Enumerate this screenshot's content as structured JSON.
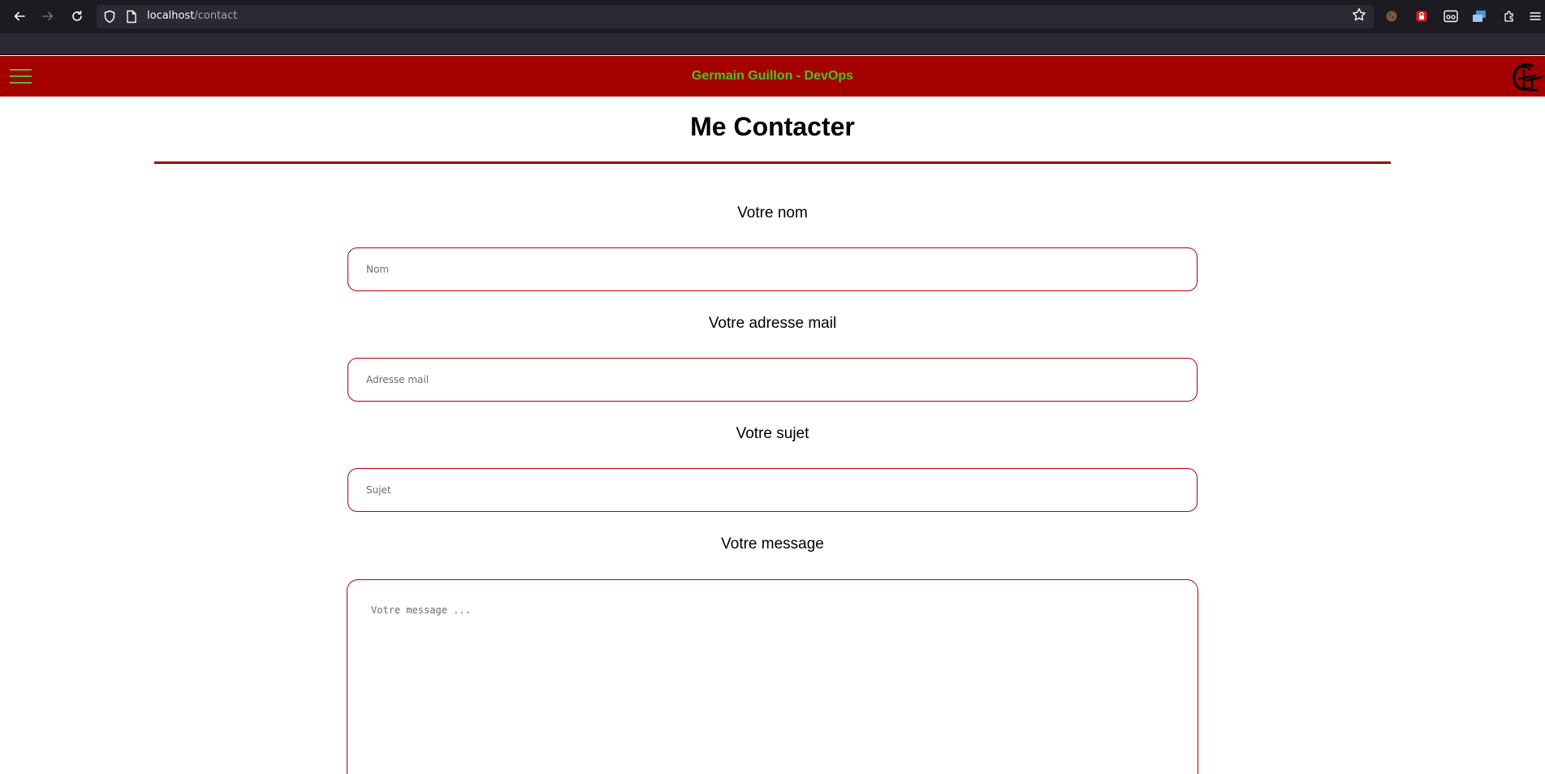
{
  "browser": {
    "url_host": "localhost",
    "url_path": "/contact"
  },
  "header": {
    "title": "Germain Guillon - DevOps",
    "background_color": "#a40000",
    "title_color": "#42c623"
  },
  "page": {
    "title": "Me Contacter"
  },
  "form": {
    "name_label": "Votre nom",
    "name_placeholder": "Nom",
    "email_label": "Votre adresse mail",
    "email_placeholder": "Adresse mail",
    "subject_label": "Votre sujet",
    "subject_placeholder": "Sujet",
    "message_label": "Votre message",
    "message_placeholder": "Votre message ...",
    "border_color": "#b0000b"
  },
  "icons": {
    "back": "back-arrow-icon",
    "forward": "forward-arrow-icon",
    "reload": "reload-icon",
    "shield": "tracking-protection-shield-icon",
    "page": "page-icon",
    "bookmark": "bookmark-star-icon",
    "menu": "hamburger-menu-icon",
    "logo": "gg-logo"
  }
}
